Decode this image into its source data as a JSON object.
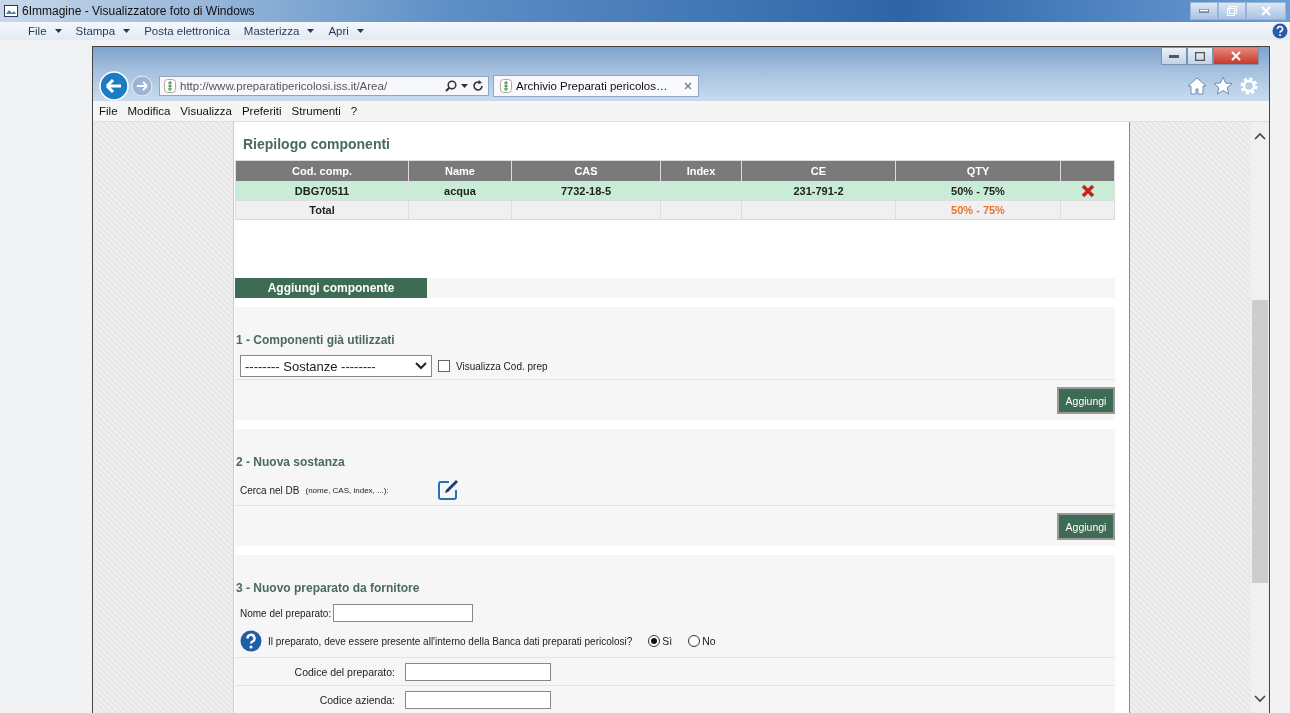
{
  "viewer": {
    "title": "6Immagine - Visualizzatore foto di Windows",
    "menu": [
      {
        "label": "File",
        "dropdown": true
      },
      {
        "label": "Stampa",
        "dropdown": true
      },
      {
        "label": "Posta elettronica",
        "dropdown": false
      },
      {
        "label": "Masterizza",
        "dropdown": true
      },
      {
        "label": "Apri",
        "dropdown": true
      }
    ]
  },
  "browser": {
    "address": "http://www.preparatipericolosi.iss.it/Area/",
    "tab": "Archivio Preparati pericolos…",
    "menu": [
      "File",
      "Modifica",
      "Visualizza",
      "Preferiti",
      "Strumenti",
      "?"
    ]
  },
  "page": {
    "summary_title": "Riepilogo componenti",
    "table": {
      "columns": [
        "Cod. comp.",
        "Name",
        "CAS",
        "Index",
        "CE",
        "QTY"
      ],
      "rows": [
        {
          "cells": [
            "DBG70511",
            "acqua",
            "7732-18-5",
            "",
            "231-791-2",
            "50% - 75%"
          ],
          "removable": true
        }
      ],
      "total": {
        "label": "Total",
        "qty": "50% - 75%"
      }
    },
    "add_tab": "Aggiungi componente",
    "section1": {
      "title": "1 - Componenti già utilizzati",
      "select": "-------- Sostanze --------",
      "checkbox": {
        "label": "Visualizza Cod. prep",
        "checked": false
      },
      "button": "Aggiungi"
    },
    "section2": {
      "title": "2 - Nuova sostanza",
      "label": "Cerca nel DB",
      "hint": "(nome, CAS, index, ...):",
      "button": "Aggiungi"
    },
    "section3": {
      "title": "3 - Nuovo preparato da fornitore",
      "name_label": "Nome del preparato:",
      "question": "Il preparato, deve essere presente all'interno della Banca dati preparati pericolosi?",
      "options": [
        {
          "label": "Sì",
          "selected": true
        },
        {
          "label": "No",
          "selected": false
        }
      ],
      "fields": [
        {
          "label": "Codice del preparato:"
        },
        {
          "label": "Codice azienda:"
        }
      ]
    }
  }
}
